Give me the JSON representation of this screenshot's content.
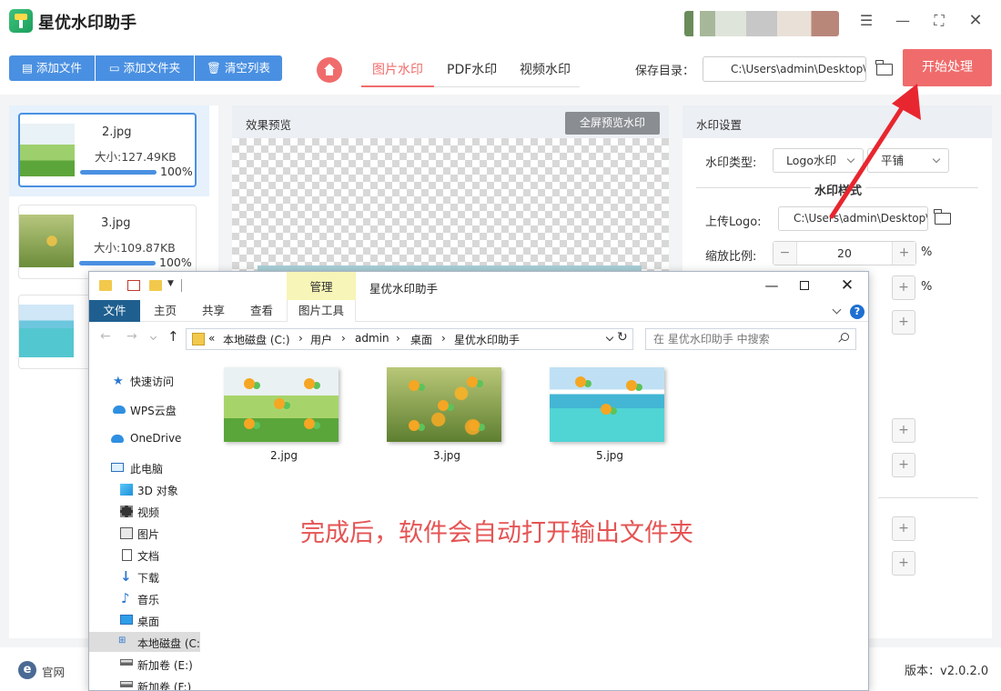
{
  "app": {
    "title": "星优水印助手"
  },
  "toolbar": {
    "add_file": "添加文件",
    "add_folder": "添加文件夹",
    "clear_list": "清空列表",
    "tabs": [
      "图片水印",
      "PDF水印",
      "视频水印"
    ],
    "save_dir_label": "保存目录：",
    "save_dir_value": "C:\\Users\\admin\\Desktop\\",
    "start": "开始处理"
  },
  "files": [
    {
      "name": "2.jpg",
      "size": "大小:127.49KB",
      "progress": "100%"
    },
    {
      "name": "3.jpg",
      "size": "大小:109.87KB",
      "progress": "100%"
    },
    {
      "name": "",
      "size": "",
      "progress": ""
    }
  ],
  "preview": {
    "title": "效果预览",
    "fullscreen": "全屏预览水印"
  },
  "settings": {
    "title": "水印设置",
    "type_label": "水印类型:",
    "type_value": "Logo水印",
    "tile_value": "平铺",
    "style_title": "水印样式",
    "upload_label": "上传Logo:",
    "logo_path": "C:\\Users\\admin\\Desktop\\",
    "scale_label": "缩放比例:",
    "scale_value": "20",
    "pct": "%",
    "pct2": "%"
  },
  "status": {
    "official": "官网",
    "version": "版本：v2.0.2.0"
  },
  "explorer": {
    "manage": "管理",
    "title": "星优水印助手",
    "ribbon": [
      "文件",
      "主页",
      "共享",
      "查看",
      "图片工具"
    ],
    "address": [
      "«",
      "本地磁盘 (C:)",
      "›",
      "用户",
      "›",
      "admin",
      "›",
      "桌面",
      "›",
      "星优水印助手"
    ],
    "search_placeholder": "在 星优水印助手 中搜索",
    "nav": [
      "快速访问",
      "WPS云盘",
      "OneDrive",
      "此电脑",
      "3D 对象",
      "视频",
      "图片",
      "文档",
      "下载",
      "音乐",
      "桌面",
      "本地磁盘 (C:",
      "新加卷 (E:)",
      "新加卷 (F:)"
    ],
    "files": [
      "2.jpg",
      "3.jpg",
      "5.jpg"
    ],
    "message": "完成后，软件会自动打开输出文件夹"
  },
  "colors": {
    "accent_blue": "#4a90e2",
    "accent_red": "#f06c6c"
  }
}
